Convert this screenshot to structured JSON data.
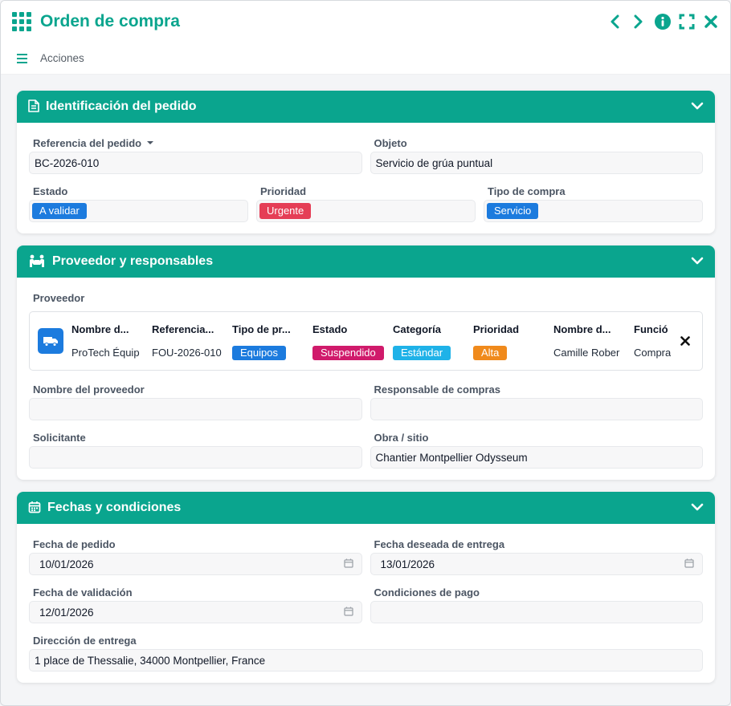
{
  "window": {
    "title": "Orden de compra",
    "accent": "#0aa58e"
  },
  "actions_bar": {
    "label": "Acciones"
  },
  "sections": {
    "identification": {
      "title": "Identificación del pedido",
      "reference_label": "Referencia del pedido",
      "reference_value": "BC-2026-010",
      "object_label": "Objeto",
      "object_value": "Servicio de grúa puntual",
      "status_label": "Estado",
      "status_value": "A validar",
      "status_color": "#1c7bde",
      "priority_label": "Prioridad",
      "priority_value": "Urgente",
      "priority_color": "#e53e56",
      "purchase_type_label": "Tipo de compra",
      "purchase_type_value": "Servicio",
      "purchase_type_color": "#1c7bde"
    },
    "supplier": {
      "title": "Proveedor y responsables",
      "supplier_label": "Proveedor",
      "card": {
        "columns": [
          {
            "header": "Nombre d...",
            "value": "ProTech Équip"
          },
          {
            "header": "Referencia...",
            "value": "FOU-2026-010"
          },
          {
            "header": "Tipo de pr...",
            "value": "Equipos",
            "badge_color": "#1c7bde"
          },
          {
            "header": "Estado",
            "value": "Suspendido",
            "badge_color": "#d01a6b"
          },
          {
            "header": "Categoría",
            "value": "Estándar",
            "badge_color": "#1fb2e8"
          },
          {
            "header": "Prioridad",
            "value": "Alta",
            "badge_color": "#f08a1c"
          },
          {
            "header": "Nombre d...",
            "value": "Camille Rober"
          },
          {
            "header": "Funció",
            "value": "Compra"
          }
        ]
      },
      "supplier_name_label": "Nombre del proveedor",
      "supplier_name_value": "",
      "purchasing_manager_label": "Responsable de compras",
      "purchasing_manager_value": "",
      "requester_label": "Solicitante",
      "requester_value": "",
      "site_label": "Obra / sitio",
      "site_value": "Chantier Montpellier Odysseum"
    },
    "dates": {
      "title": "Fechas y condiciones",
      "order_date_label": "Fecha de pedido",
      "order_date_value": "10/01/2026",
      "desired_delivery_label": "Fecha deseada de entrega",
      "desired_delivery_value": "13/01/2026",
      "validation_date_label": "Fecha de validación",
      "validation_date_value": "12/01/2026",
      "payment_terms_label": "Condiciones de pago",
      "payment_terms_value": "",
      "delivery_address_label": "Dirección de entrega",
      "delivery_address_value": "1 place de Thessalie, 34000 Montpellier, France"
    }
  }
}
